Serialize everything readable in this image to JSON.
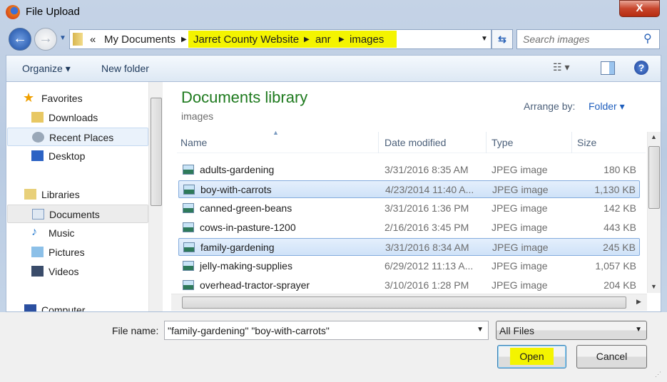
{
  "window": {
    "title": "File Upload",
    "close": "X"
  },
  "address": {
    "overflow": "«",
    "crumbs": [
      "My Documents",
      "Jarret County Website",
      "anr",
      "images"
    ]
  },
  "search": {
    "placeholder": "Search images"
  },
  "toolbar": {
    "organize": "Organize ▾",
    "new_folder": "New folder"
  },
  "nav": {
    "favorites": "Favorites",
    "downloads": "Downloads",
    "recent": "Recent Places",
    "desktop": "Desktop",
    "libraries": "Libraries",
    "documents": "Documents",
    "music": "Music",
    "pictures": "Pictures",
    "videos": "Videos",
    "computer": "Computer"
  },
  "library": {
    "title": "Documents library",
    "subtitle": "images",
    "arrange_label": "Arrange by:",
    "arrange_value": "Folder ▾"
  },
  "columns": {
    "name": "Name",
    "date": "Date modified",
    "type": "Type",
    "size": "Size"
  },
  "files": [
    {
      "name": "adults-gardening",
      "date": "3/31/2016 8:35 AM",
      "type": "JPEG image",
      "size": "180 KB",
      "selected": false
    },
    {
      "name": "boy-with-carrots",
      "date": "4/23/2014 11:40 A...",
      "type": "JPEG image",
      "size": "1,130 KB",
      "selected": true
    },
    {
      "name": "canned-green-beans",
      "date": "3/31/2016 1:36 PM",
      "type": "JPEG image",
      "size": "142 KB",
      "selected": false
    },
    {
      "name": "cows-in-pasture-1200",
      "date": "2/16/2016 3:45 PM",
      "type": "JPEG image",
      "size": "443 KB",
      "selected": false
    },
    {
      "name": "family-gardening",
      "date": "3/31/2016 8:34 AM",
      "type": "JPEG image",
      "size": "245 KB",
      "selected": true
    },
    {
      "name": "jelly-making-supplies",
      "date": "6/29/2012 11:13 A...",
      "type": "JPEG image",
      "size": "1,057 KB",
      "selected": false
    },
    {
      "name": "overhead-tractor-sprayer",
      "date": "3/10/2016 1:28 PM",
      "type": "JPEG image",
      "size": "204 KB",
      "selected": false
    }
  ],
  "footer": {
    "filename_label": "File name:",
    "filename_value": "\"family-gardening\" \"boy-with-carrots\"",
    "filter": "All Files",
    "open": "Open",
    "cancel": "Cancel"
  },
  "colors": {
    "highlight": "#f4f400",
    "library_title": "#1e7a1e",
    "link": "#1e5ebd"
  }
}
